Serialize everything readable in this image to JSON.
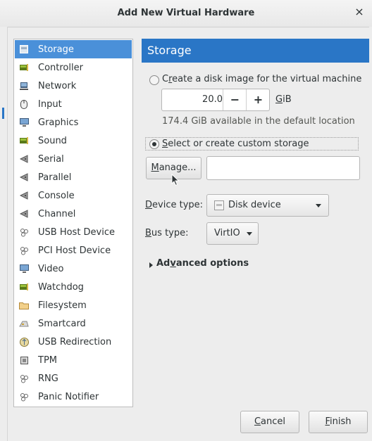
{
  "window": {
    "title": "Add New Virtual Hardware",
    "close_glyph": "×"
  },
  "sidebar": {
    "items": [
      {
        "label": "Storage",
        "icon": "storage-icon",
        "selected": true
      },
      {
        "label": "Controller",
        "icon": "controller-icon"
      },
      {
        "label": "Network",
        "icon": "network-icon"
      },
      {
        "label": "Input",
        "icon": "mouse-icon"
      },
      {
        "label": "Graphics",
        "icon": "monitor-icon"
      },
      {
        "label": "Sound",
        "icon": "sound-card-icon"
      },
      {
        "label": "Serial",
        "icon": "serial-port-icon"
      },
      {
        "label": "Parallel",
        "icon": "parallel-port-icon"
      },
      {
        "label": "Console",
        "icon": "console-port-icon"
      },
      {
        "label": "Channel",
        "icon": "channel-port-icon"
      },
      {
        "label": "USB Host Device",
        "icon": "usb-device-icon"
      },
      {
        "label": "PCI Host Device",
        "icon": "pci-device-icon"
      },
      {
        "label": "Video",
        "icon": "video-icon"
      },
      {
        "label": "Watchdog",
        "icon": "watchdog-icon"
      },
      {
        "label": "Filesystem",
        "icon": "folder-icon"
      },
      {
        "label": "Smartcard",
        "icon": "smartcard-icon"
      },
      {
        "label": "USB Redirection",
        "icon": "usb-redirection-icon"
      },
      {
        "label": "TPM",
        "icon": "tpm-chip-icon"
      },
      {
        "label": "RNG",
        "icon": "rng-icon"
      },
      {
        "label": "Panic Notifier",
        "icon": "panic-notifier-icon"
      }
    ]
  },
  "storage": {
    "header": "Storage",
    "create_option": {
      "mnemonic": "r",
      "pre": "C",
      "post": "eate a disk image for the virtual machine"
    },
    "size_value": "20.0",
    "minus": "−",
    "plus": "+",
    "size_unit_mnemonic": "G",
    "size_unit_rest": "iB",
    "available": "174.4 GiB available in the default location",
    "custom_option": {
      "mnemonic": "S",
      "rest": "elect or create custom storage"
    },
    "manage": {
      "mnemonic": "M",
      "rest": "anage..."
    },
    "path_value": "",
    "device_type": {
      "mnemonic": "D",
      "rest": "evice type:",
      "value": "Disk device"
    },
    "bus_type": {
      "mnemonic": "B",
      "rest": "us type:",
      "value": "VirtIO"
    },
    "advanced": {
      "pre": "Ad",
      "mnemonic": "v",
      "post": "anced options"
    }
  },
  "footer": {
    "cancel": {
      "mnemonic": "C",
      "rest": "ancel"
    },
    "finish": {
      "mnemonic": "F",
      "rest": "inish"
    }
  },
  "colors": {
    "selection": "#4a90d9",
    "header": "#2a76c6"
  }
}
